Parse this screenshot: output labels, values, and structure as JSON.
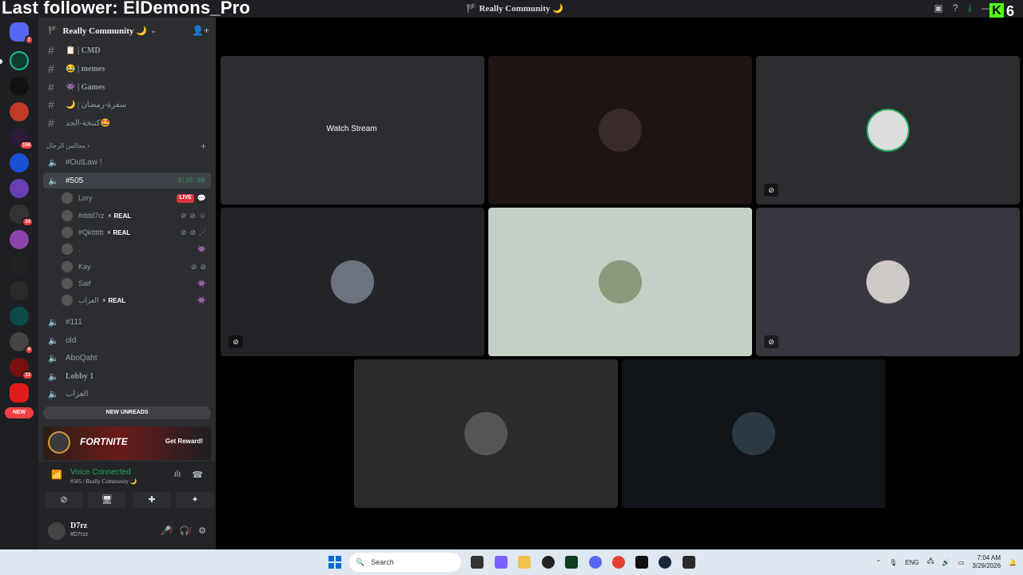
{
  "overlay": {
    "follower_text": "Last follower: ElDemons_Pro",
    "kick_count": "6",
    "kick_letter": "K"
  },
  "window": {
    "title": "🏴 Really Community 🌙"
  },
  "server": {
    "name": "Really Community 🌙",
    "chevron": "⌄"
  },
  "channels": [
    {
      "label": "📋 | CMD",
      "type": "text"
    },
    {
      "label": "😂 | memes",
      "type": "text"
    },
    {
      "label": "👾 | Games",
      "type": "text"
    },
    {
      "label": "🌙 | سفرة-رمضان",
      "type": "text"
    },
    {
      "label": "كتنخة-الجد🤩",
      "type": "text"
    }
  ],
  "category": {
    "label": "مجالس الرجال ›"
  },
  "voice_channels": [
    {
      "label": "#OutLaw !"
    },
    {
      "label": "#505",
      "timer": "1:25:38"
    },
    {
      "label": "#111"
    },
    {
      "label": "old"
    },
    {
      "label": "AboQaht"
    },
    {
      "label": "Lobby 1"
    },
    {
      "label": "العزاب"
    }
  ],
  "voice_users": [
    {
      "name": "Lory",
      "tag": "",
      "badge": "LIVE"
    },
    {
      "name": "#ddd7rz",
      "tag": "⚡ REAL",
      "badge": ""
    },
    {
      "name": "#Qktttttt",
      "tag": "⚡ REAL",
      "badge": ""
    },
    {
      "name": ".",
      "tag": "",
      "badge": ""
    },
    {
      "name": "Kay",
      "tag": "",
      "badge": ""
    },
    {
      "name": "Saif",
      "tag": "",
      "badge": ""
    },
    {
      "name": "العزاب",
      "tag": "⚡ REAL",
      "badge": ""
    }
  ],
  "new_unreads": "NEW UNREADS",
  "rail_new": "NEW",
  "rail_badges": [
    "1",
    "156",
    "14",
    "4",
    "13"
  ],
  "promo": {
    "title": "FORTNITE",
    "button": "Get Reward!"
  },
  "voice_status": {
    "title": "Voice Connected",
    "subtitle": "#505 / Really Community 🌙"
  },
  "user": {
    "name": "D7rz",
    "tag": "#D7rzz"
  },
  "stage": {
    "watch_stream": "Watch Stream"
  },
  "taskbar": {
    "search_placeholder": "Search",
    "lang": "ENG",
    "time": "7:04 AM",
    "date": "3/29/2026"
  },
  "colors": {
    "accent_green": "#23a55a",
    "danger_red": "#f23f43",
    "kick_green": "#53fc18"
  }
}
